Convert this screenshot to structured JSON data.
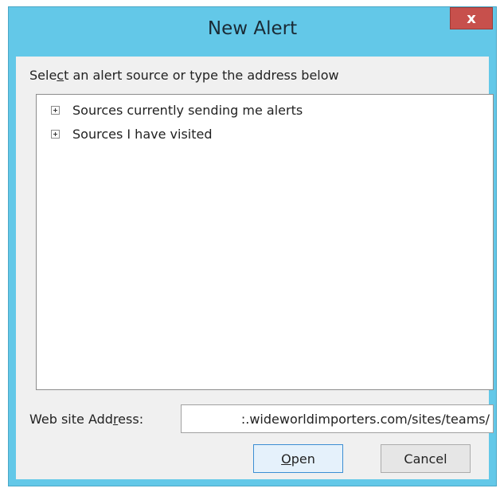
{
  "dialog": {
    "title": "New Alert",
    "close_label": "x",
    "prompt": {
      "before": "Sele",
      "accel": "c",
      "after": "t an alert source or type the address below"
    },
    "tree_items": [
      {
        "label": "Sources currently sending me alerts",
        "icon": "plus-expander-icon"
      },
      {
        "label": "Sources I have visited",
        "icon": "plus-expander-icon"
      }
    ],
    "address": {
      "label_before": "Web site Add",
      "label_accel": "r",
      "label_after": "ess:",
      "value": ":.wideworldimporters.com/sites/teams/"
    },
    "buttons": {
      "open": {
        "accel": "O",
        "rest": "pen"
      },
      "cancel": "Cancel"
    }
  },
  "colors": {
    "frame": "#63c8e8",
    "close": "#c7504c",
    "client": "#f0f0f0",
    "default_button_border": "#3c8ed3"
  }
}
